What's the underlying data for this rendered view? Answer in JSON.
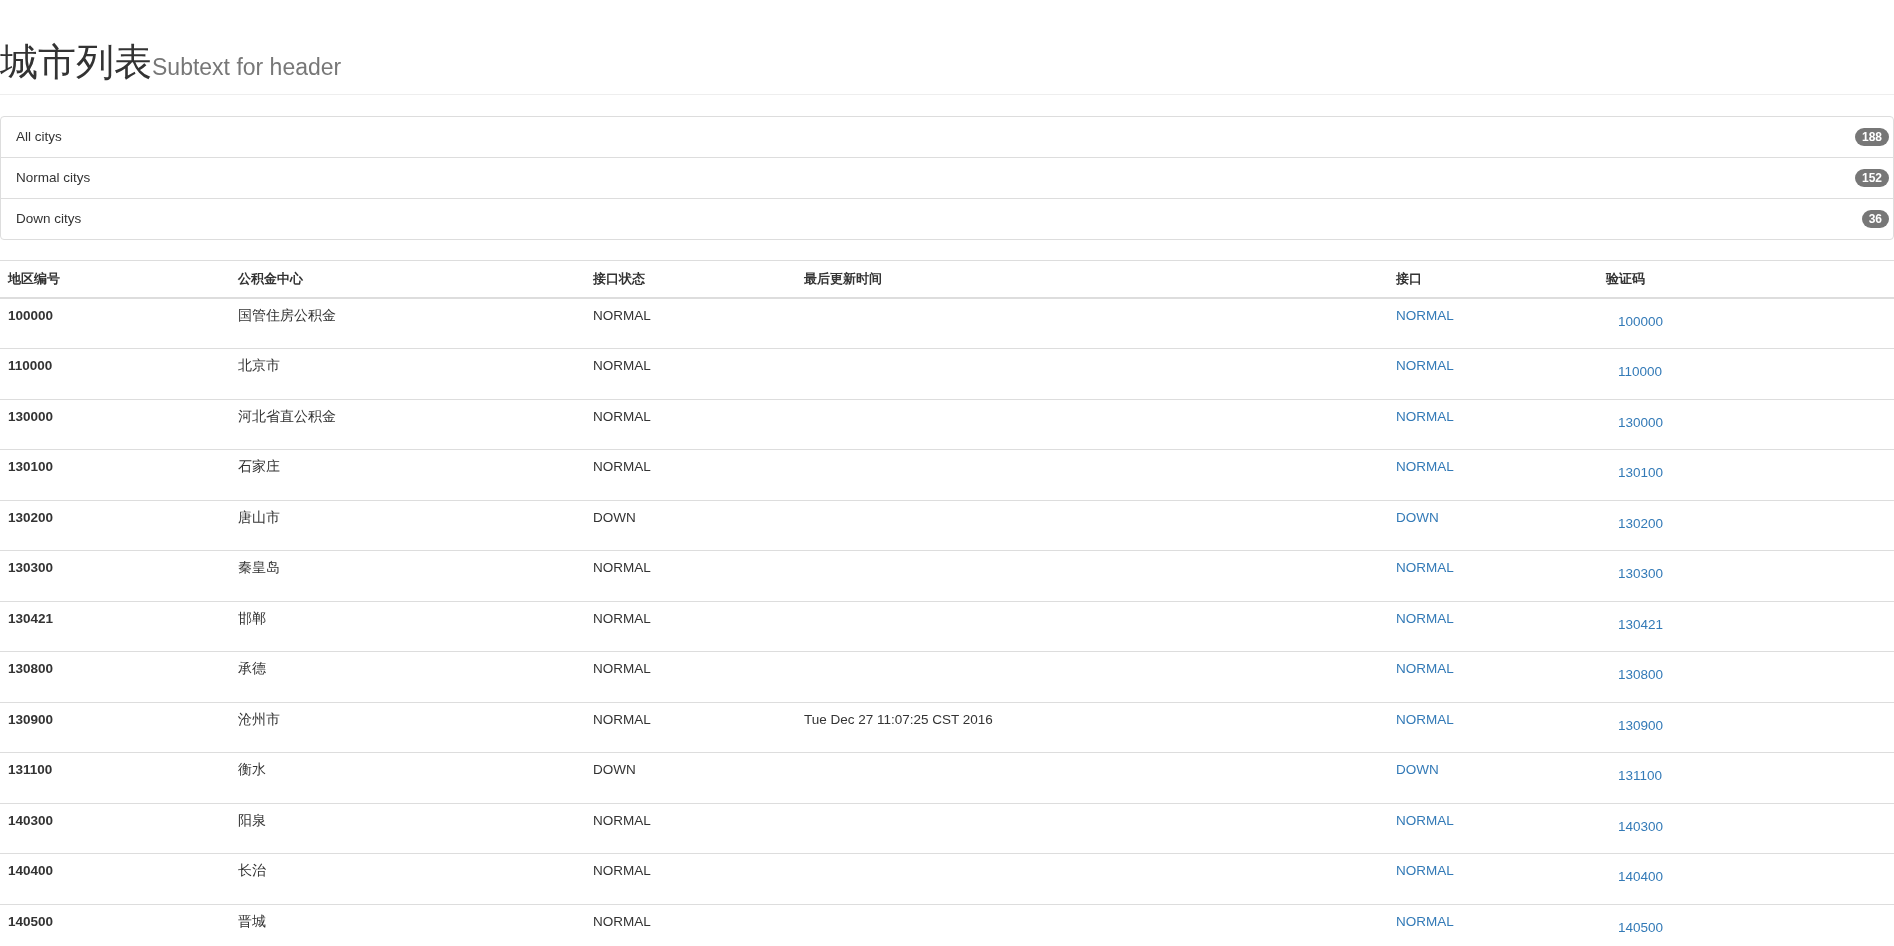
{
  "header": {
    "title": "城市列表",
    "subtext": "Subtext for header"
  },
  "summary": [
    {
      "label": "All citys",
      "count": "188"
    },
    {
      "label": "Normal citys",
      "count": "152"
    },
    {
      "label": "Down citys",
      "count": "36"
    }
  ],
  "table": {
    "columns": [
      "地区编号",
      "公积金中心",
      "接口状态",
      "最后更新时间",
      "接口",
      "验证码"
    ],
    "rows": [
      {
        "code": "100000",
        "center": "国管住房公积金",
        "status": "NORMAL",
        "updated": "",
        "interface": "NORMAL",
        "captcha": "100000"
      },
      {
        "code": "110000",
        "center": "北京市",
        "status": "NORMAL",
        "updated": "",
        "interface": "NORMAL",
        "captcha": "110000"
      },
      {
        "code": "130000",
        "center": "河北省直公积金",
        "status": "NORMAL",
        "updated": "",
        "interface": "NORMAL",
        "captcha": "130000"
      },
      {
        "code": "130100",
        "center": "石家庄",
        "status": "NORMAL",
        "updated": "",
        "interface": "NORMAL",
        "captcha": "130100"
      },
      {
        "code": "130200",
        "center": "唐山市",
        "status": "DOWN",
        "updated": "",
        "interface": "DOWN",
        "captcha": "130200"
      },
      {
        "code": "130300",
        "center": "秦皇岛",
        "status": "NORMAL",
        "updated": "",
        "interface": "NORMAL",
        "captcha": "130300"
      },
      {
        "code": "130421",
        "center": "邯郸",
        "status": "NORMAL",
        "updated": "",
        "interface": "NORMAL",
        "captcha": "130421"
      },
      {
        "code": "130800",
        "center": "承德",
        "status": "NORMAL",
        "updated": "",
        "interface": "NORMAL",
        "captcha": "130800"
      },
      {
        "code": "130900",
        "center": "沧州市",
        "status": "NORMAL",
        "updated": "Tue Dec 27 11:07:25 CST 2016",
        "interface": "NORMAL",
        "captcha": "130900"
      },
      {
        "code": "131100",
        "center": "衡水",
        "status": "DOWN",
        "updated": "",
        "interface": "DOWN",
        "captcha": "131100"
      },
      {
        "code": "140300",
        "center": "阳泉",
        "status": "NORMAL",
        "updated": "",
        "interface": "NORMAL",
        "captcha": "140300"
      },
      {
        "code": "140400",
        "center": "长治",
        "status": "NORMAL",
        "updated": "",
        "interface": "NORMAL",
        "captcha": "140400"
      },
      {
        "code": "140500",
        "center": "晋城",
        "status": "NORMAL",
        "updated": "",
        "interface": "NORMAL",
        "captcha": "140500"
      }
    ]
  }
}
